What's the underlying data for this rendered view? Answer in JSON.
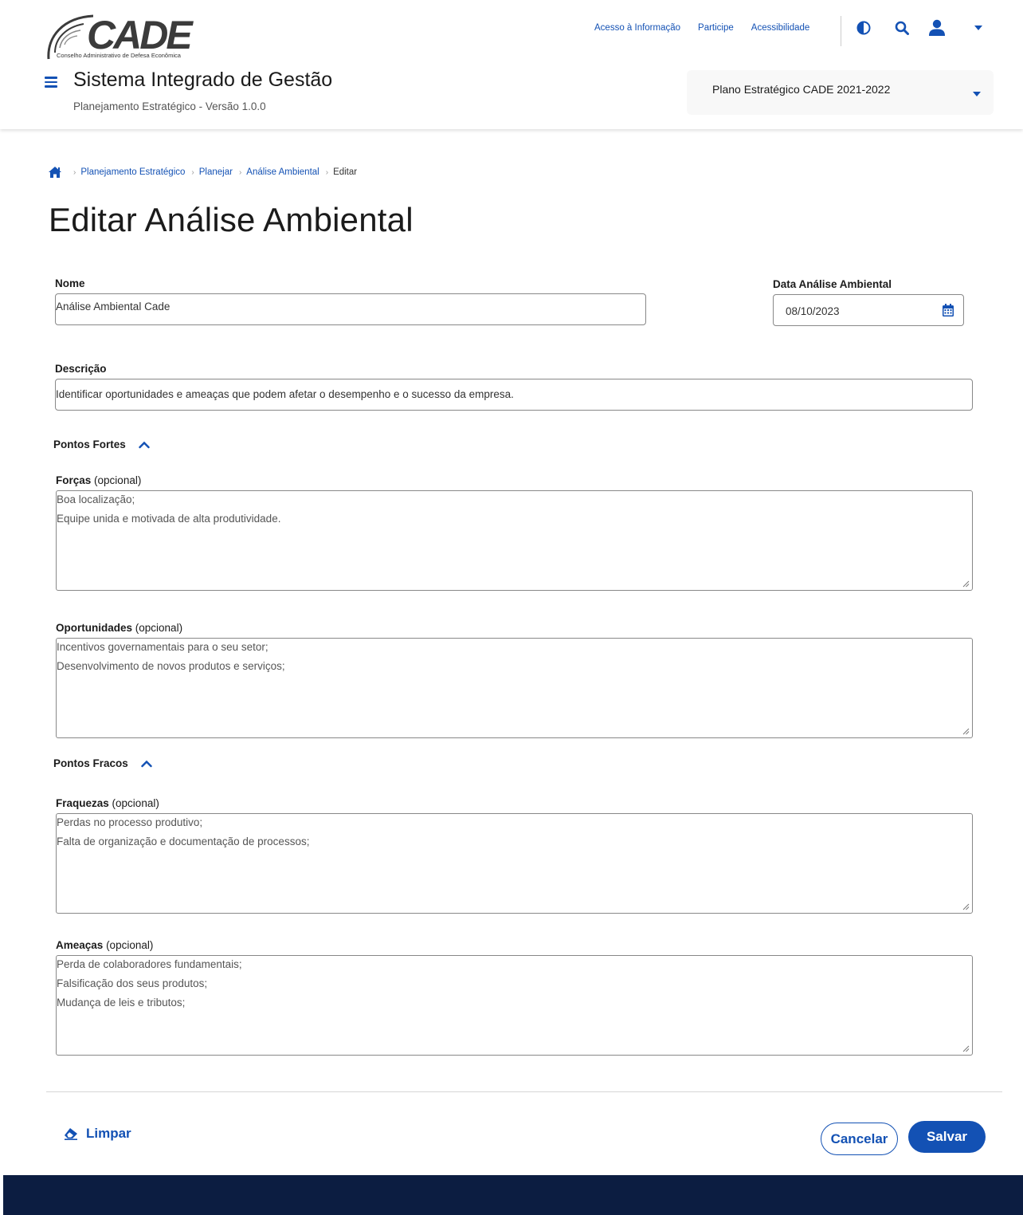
{
  "header": {
    "logo_text": "CADE",
    "logo_subtitle": "Conselho Administrativo de Defesa Econômica",
    "top_links": [
      "Acesso à Informação",
      "Participe",
      "Acessibilidade"
    ],
    "system_title": "Sistema Integrado de Gestão",
    "system_subtitle": "Planejamento Estratégico - Versão 1.0.0",
    "plan_select_value": "Plano Estratégico CADE 2021-2022"
  },
  "breadcrumb": {
    "items": [
      "Planejamento Estratégico",
      "Planejar",
      "Análise Ambiental"
    ],
    "current": "Editar"
  },
  "page_title": "Editar Análise Ambiental",
  "form": {
    "nome": {
      "label": "Nome",
      "value": "Análise Ambiental Cade"
    },
    "data": {
      "label": "Data  Análise Ambiental",
      "value": "08/10/2023"
    },
    "descricao": {
      "label": "Descrição",
      "value": "Identificar oportunidades e ameaças que podem afetar o desempenho e o sucesso da empresa."
    },
    "pontos_fortes": {
      "label": "Pontos Fortes"
    },
    "forcas": {
      "label": "Forças",
      "optional": "(opcional)",
      "lines": [
        "Boa localização;",
        "Equipe unida e motivada de alta produtividade."
      ]
    },
    "oportunidades": {
      "label": "Oportunidades",
      "optional": "(opcional)",
      "lines": [
        "Incentivos governamentais para o seu setor;",
        "Desenvolvimento de novos produtos e serviços;"
      ]
    },
    "pontos_fracos": {
      "label": "Pontos Fracos"
    },
    "fraquezas": {
      "label": "Fraquezas",
      "optional": "(opcional)",
      "lines": [
        "Perdas no processo produtivo;",
        "Falta de organização e documentação de processos;"
      ]
    },
    "ameacas": {
      "label": "Ameaças",
      "optional": "(opcional)",
      "lines": [
        "Perda de colaboradores fundamentais;",
        "Falsificação dos seus produtos;",
        "Mudança de leis e tributos;"
      ]
    }
  },
  "actions": {
    "clear_label": "Limpar",
    "cancel_label": "Cancelar",
    "save_label": "Salvar"
  },
  "colors": {
    "primary": "#1351b4",
    "footer": "#0c1d41",
    "select_bg": "#f8f8f8"
  },
  "icons": [
    "menu-icon",
    "contrast-icon",
    "search-icon",
    "user-icon",
    "caret-down-icon",
    "home-icon",
    "calendar-icon",
    "chevron-up-icon",
    "eraser-icon"
  ]
}
